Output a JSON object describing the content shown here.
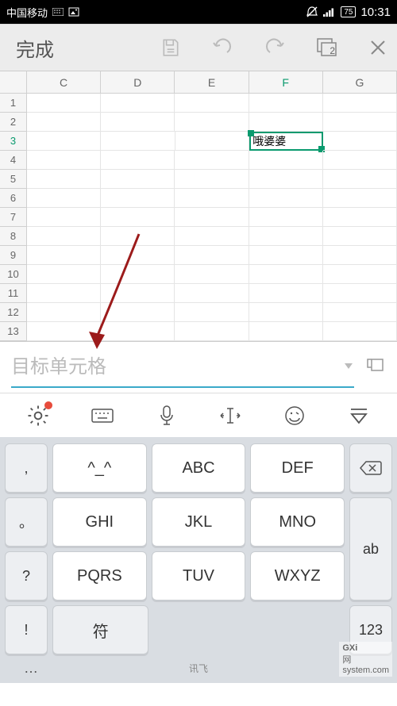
{
  "status": {
    "carrier": "中国移动",
    "battery": "75",
    "time": "10:31"
  },
  "toolbar": {
    "done": "完成",
    "tab_count": "2"
  },
  "sheet": {
    "columns": [
      "C",
      "D",
      "E",
      "F",
      "G"
    ],
    "rows": [
      "1",
      "2",
      "3",
      "4",
      "5",
      "6",
      "7",
      "8",
      "9",
      "10",
      "11",
      "12",
      "13"
    ],
    "selected_col": "F",
    "selected_row": "3",
    "cell_value": "哦婆婆"
  },
  "input": {
    "placeholder": "目标单元格"
  },
  "keyboard": {
    "left_side": [
      ",",
      "。",
      "?",
      "!",
      "…"
    ],
    "right_side_backspace": "⌫",
    "right_side": [
      "ab",
      "123"
    ],
    "main_rows": [
      [
        "^_^",
        "ABC",
        "DEF"
      ],
      [
        "GHI",
        "JKL",
        "MNO"
      ],
      [
        "PQRS",
        "TUV",
        "WXYZ"
      ]
    ],
    "bottom_left": "符",
    "ime_label": "讯飞"
  },
  "watermark": {
    "brand": "GXi",
    "domain": "system.com",
    "suffix": "网"
  }
}
